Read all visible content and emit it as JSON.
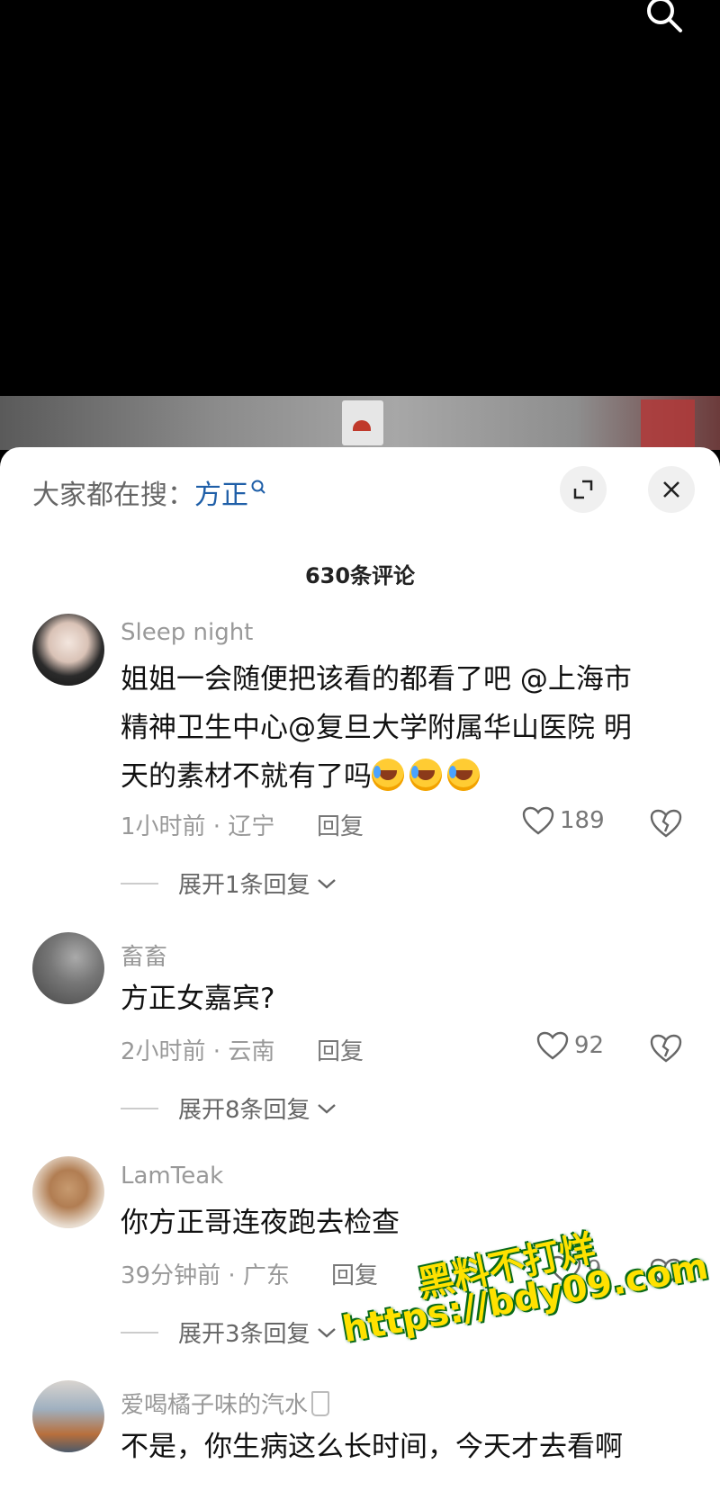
{
  "video": {
    "search_icon": "search-icon"
  },
  "sheet": {
    "hot_search_label": "大家都在搜：",
    "hot_search_keyword": "方正",
    "comment_count": "630条评论"
  },
  "comments": [
    {
      "username": "Sleep night",
      "text_lines": [
        "姐姐一会随便把该看的都看了吧 @上海市",
        "精神卫生中心@复旦大学附属华山医院 明",
        "天的素材不就有了吗"
      ],
      "time_location": "1小时前 · 辽宁",
      "reply": "回复",
      "likes": "189",
      "expand": "展开1条回复"
    },
    {
      "username": "畜畜",
      "text_lines": [
        "方正女嘉宾?"
      ],
      "time_location": "2小时前 · 云南",
      "reply": "回复",
      "likes": "92",
      "expand": "展开8条回复"
    },
    {
      "username": "LamTeak",
      "text_lines": [
        "你方正哥连夜跑去检查"
      ],
      "time_location": "39分钟前 · 广东",
      "reply": "回复",
      "likes": "9",
      "expand": "展开3条回复"
    },
    {
      "username": "爱喝橘子味的汽水",
      "text_lines": [
        "不是，你生病这么长时间，今天才去看啊"
      ]
    }
  ],
  "watermark": {
    "line1": "黑料不打烊",
    "line2": "https://bdy09.com"
  }
}
